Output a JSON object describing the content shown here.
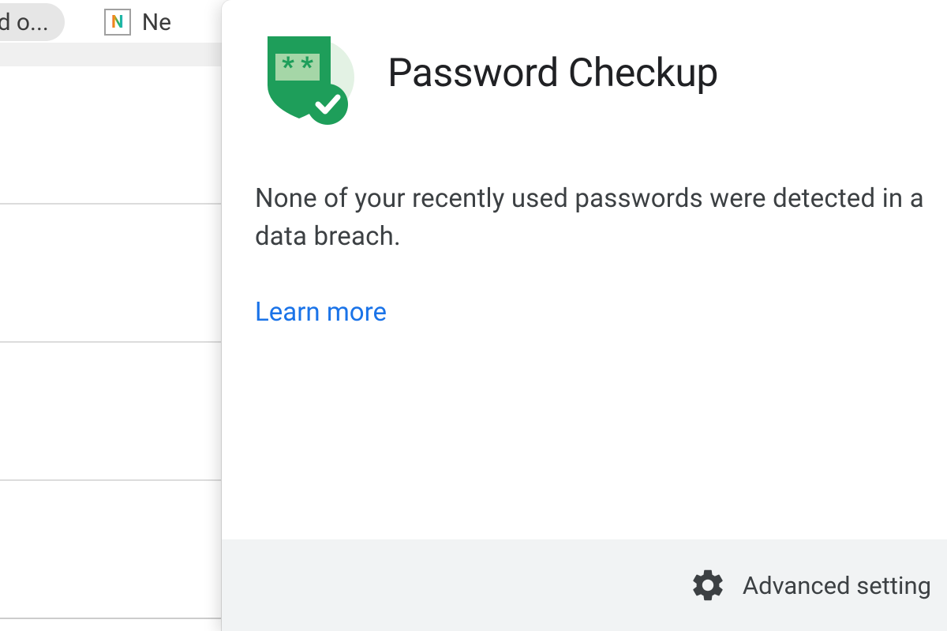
{
  "bookmarks": {
    "fragment_1": "nd o...",
    "item_2_label": "Ne"
  },
  "popup": {
    "title": "Password Checkup",
    "message": "None of your recently used passwords were detected in a data breach.",
    "learn_more": "Learn more",
    "advanced_settings": "Advanced setting"
  }
}
